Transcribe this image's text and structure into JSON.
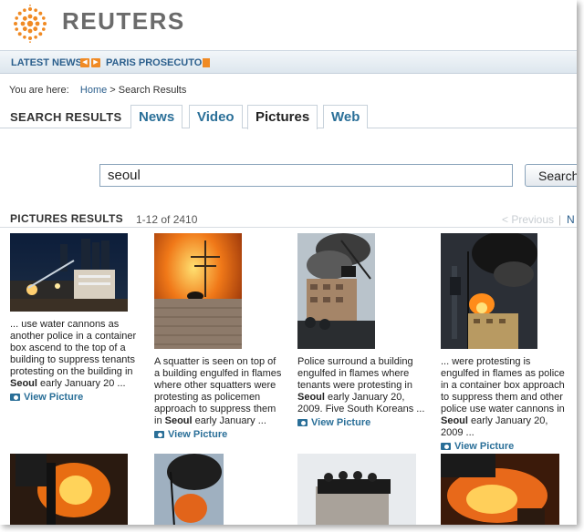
{
  "header": {
    "brand": "REUTERS"
  },
  "ticker": {
    "label": "LATEST NEWS",
    "headline": "PARIS PROSECUTOR"
  },
  "breadcrumb": {
    "prefix": "You are here:",
    "home": "Home",
    "current": "> Search Results"
  },
  "tabs": {
    "section_title": "SEARCH RESULTS",
    "items": [
      {
        "label": "News"
      },
      {
        "label": "Video"
      },
      {
        "label": "Pictures"
      },
      {
        "label": "Web"
      }
    ]
  },
  "search": {
    "query": "seoul",
    "button": "Search"
  },
  "results": {
    "title": "PICTURES RESULTS",
    "count": "1-12 of 2410",
    "prev": "< Previous",
    "sep": "|",
    "next": "N",
    "view_label": "View Picture",
    "cards": [
      {
        "pre": "... use water cannons as another police in a container box ascend to the top of a building to suppress tenants protesting on the building in ",
        "bold": "Seoul",
        "post": " early January 20 ..."
      },
      {
        "pre": "A squatter is seen on top of a building engulfed in flames where other squatters were protesting as policemen approach to suppress them in ",
        "bold": "Seoul",
        "post": " early January ..."
      },
      {
        "pre": "Police surround a building engulfed in flames where tenants were protesting in ",
        "bold": "Seoul",
        "post": " early January 20, 2009. Five South Koreans ..."
      },
      {
        "pre": "... were protesting is engulfed in flames as police in a container box approach to suppress them and other police use water cannons in ",
        "bold": "Seoul",
        "post": " early January 20, 2009 ..."
      }
    ]
  },
  "colors": {
    "link": "#2a6f98",
    "accent": "#f08a24",
    "brand_gray": "#6b6b6b"
  }
}
